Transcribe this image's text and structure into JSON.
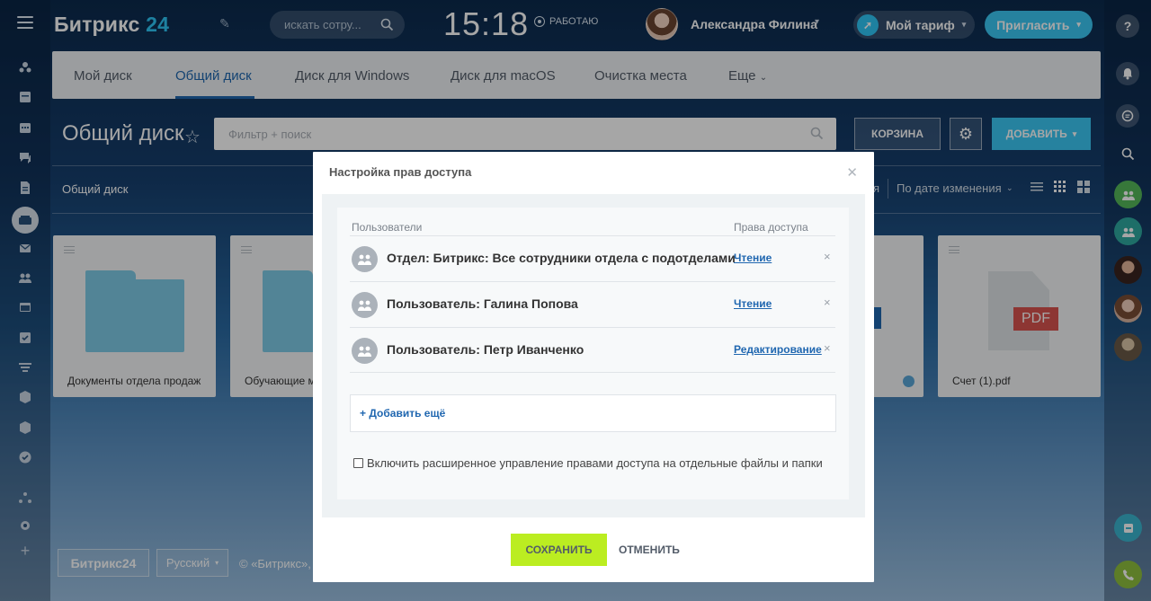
{
  "header": {
    "logo_text": "Битрикс",
    "logo_num": "24",
    "search_placeholder": "искать сотру...",
    "clock": "15:18",
    "work_status": "РАБОТАЮ",
    "user_name": "Александра Филина",
    "tariff_label": "Мой тариф",
    "invite_label": "Пригласить"
  },
  "subnav": {
    "tabs": [
      {
        "label": "Мой диск"
      },
      {
        "label": "Общий диск"
      },
      {
        "label": "Диск для Windows"
      },
      {
        "label": "Диск для macOS"
      },
      {
        "label": "Очистка места"
      },
      {
        "label": "Еще"
      }
    ],
    "active_tab": "Общий диск"
  },
  "toolbar": {
    "page_title": "Общий диск",
    "filter_placeholder": "Фильтр + поиск",
    "trash_label": "КОРЗИНА",
    "add_label": "ДОБАВИТЬ"
  },
  "breadcrumb": "Общий диск",
  "sort": {
    "partial_label": "я",
    "label": "По дате изменения"
  },
  "files": [
    {
      "name": "Документы отдела продаж",
      "kind": "folder"
    },
    {
      "name": "Обучающие м",
      "kind": "folder"
    },
    {
      "name": "Счет (1).pdf",
      "kind": "pdf",
      "badge": "PDF"
    }
  ],
  "modal": {
    "title": "Настройка прав доступа",
    "col_users": "Пользователи",
    "col_rights": "Права доступа",
    "rows": [
      {
        "name": "Отдел: Битрикс: Все сотрудники отдела с подотделами",
        "right": "Чтение"
      },
      {
        "name": "Пользователь: Галина Попова",
        "right": "Чтение"
      },
      {
        "name": "Пользователь: Петр Иванченко",
        "right": "Редактирование"
      }
    ],
    "add_more": "+ Добавить ещё",
    "extended_checkbox_label": "Включить расширенное управление правами доступа на отдельные файлы и папки",
    "save_label": "СОХРАНИТЬ",
    "cancel_label": "ОТМЕНИТЬ"
  },
  "footer": {
    "logo": "Битрикс24",
    "language": "Русский",
    "copyright": "© «Битрикс»,"
  },
  "colors": {
    "accent": "#2fc6f6",
    "link": "#2067b0",
    "save_button": "#bbed21",
    "folder": "#7fcbe6",
    "pdf_badge": "#d9534f"
  }
}
